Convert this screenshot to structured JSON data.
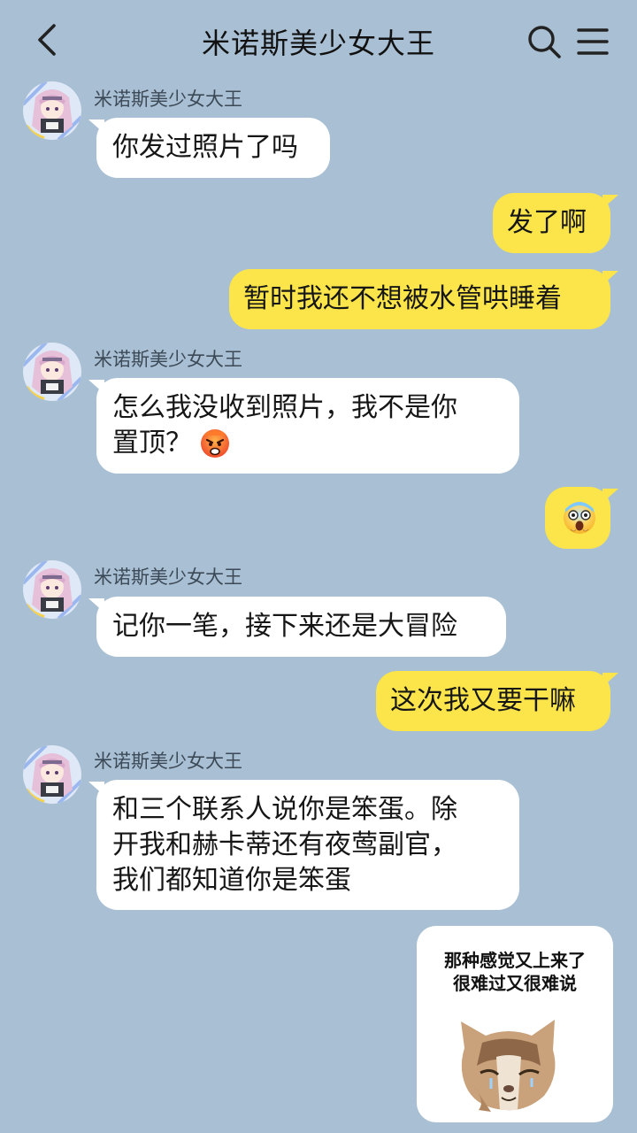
{
  "header": {
    "title": "米诺斯美少女大王"
  },
  "messages": {
    "m1": {
      "sender": "米诺斯美少女大王",
      "text": "你发过照片了吗"
    },
    "m2": {
      "text": "发了啊"
    },
    "m3": {
      "text": "暂时我还不想被水管哄睡着"
    },
    "m4": {
      "sender": "米诺斯美少女大王",
      "line1": "怎么我没收到照片，我不是你",
      "line2": "置顶？",
      "emoji": "angry-face-emoji"
    },
    "m5": {
      "emoji": "scared-face-emoji"
    },
    "m6": {
      "sender": "米诺斯美少女大王",
      "text": "记你一笔，接下来还是大冒险"
    },
    "m7": {
      "text": "这次我又要干嘛"
    },
    "m8": {
      "sender": "米诺斯美少女大王",
      "line1": "和三个联系人说你是笨蛋。除",
      "line2": "开我和赫卡蒂还有夜莺副官，",
      "line3": "我们都知道你是笨蛋"
    },
    "m9": {
      "sticker_line1": "那种感觉又上来了",
      "sticker_line2": "很难过又很难说",
      "sticker_image": "crying-cat-sticker"
    }
  },
  "colors": {
    "background": "#a9bfd3",
    "incoming_bubble": "#ffffff",
    "outgoing_bubble": "#fbe54a"
  }
}
